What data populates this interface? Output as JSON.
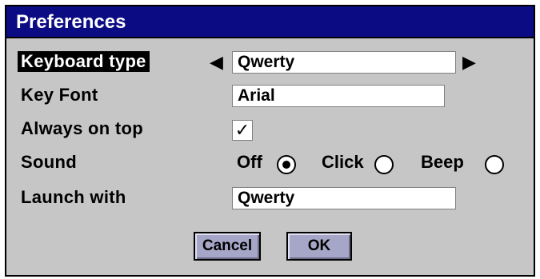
{
  "window": {
    "title": "Preferences"
  },
  "rows": {
    "keyboard_type": {
      "label": "Keyboard type",
      "value": "Qwerty"
    },
    "key_font": {
      "label": "Key Font",
      "value": "Arial"
    },
    "always_on_top": {
      "label": "Always on top",
      "checked": true,
      "mark": "✓"
    },
    "sound": {
      "label": "Sound",
      "options": [
        {
          "label": "Off",
          "selected": true
        },
        {
          "label": "Click",
          "selected": false
        },
        {
          "label": "Beep",
          "selected": false
        }
      ]
    },
    "launch_with": {
      "label": "Launch with",
      "value": "Qwerty"
    }
  },
  "buttons": {
    "cancel": "Cancel",
    "ok": "OK"
  },
  "icons": {
    "prev": "◀",
    "next": "▶"
  },
  "colors": {
    "titlebar": "#0b0b84",
    "dialog_bg": "#c6c6c6",
    "button_bg": "#a6a6c8"
  }
}
